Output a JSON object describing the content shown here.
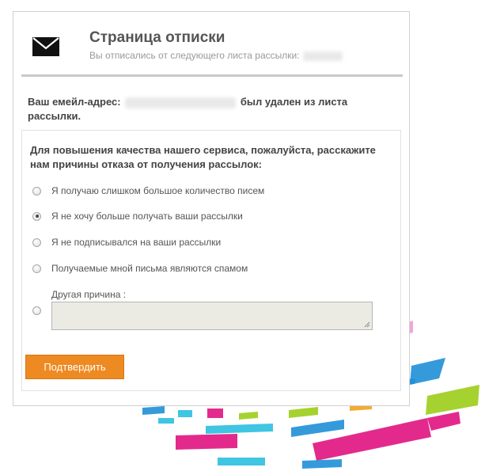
{
  "header": {
    "icon": "envelope-icon",
    "title": "Страница отписки",
    "subtitle": "Вы отписались от следующего листа рассылки:"
  },
  "confirmation": {
    "prefix": "Ваш емейл-адрес:",
    "suffix": "был удален из листа рассылки."
  },
  "survey": {
    "question": "Для повышения качества нашего сервиса, пожалуйста, расскажите нам причины отказа от получения рассылок:",
    "options": [
      {
        "label": "Я получаю слишком большое количество писем",
        "checked": false
      },
      {
        "label": "Я не хочу больше получать ваши рассылки",
        "checked": true
      },
      {
        "label": "Я не подписывался на ваши рассылки",
        "checked": false
      },
      {
        "label": "Получаемые мной письма являются спамом",
        "checked": false
      }
    ],
    "other": {
      "label": "Другая причина :",
      "value": "",
      "checked": false
    }
  },
  "submit_label": "Подтвердить",
  "colors": {
    "accent": "#ee8a22",
    "stripes": [
      "#e0137f",
      "#1f8fd6",
      "#9ccd1a",
      "#2bbfe0",
      "#f39ad0",
      "#f2a31d"
    ]
  }
}
